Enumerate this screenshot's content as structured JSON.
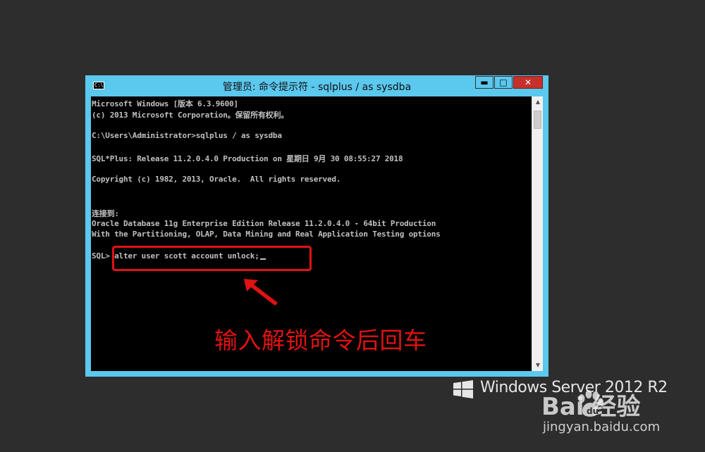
{
  "window": {
    "title": "管理员: 命令提示符 - sqlplus  / as sysdba",
    "icon_label": "C:\\",
    "minimize_label": "▬",
    "maximize_label": "□",
    "close_label": "✕"
  },
  "console": {
    "lines": [
      "Microsoft Windows [版本 6.3.9600]",
      "(c) 2013 Microsoft Corporation。保留所有权利。",
      "",
      "C:\\Users\\Administrator>sqlplus / as sysdba",
      "",
      "SQL*Plus: Release 11.2.0.4.0 Production on 星期日 9月 30 08:55:27 2018",
      "",
      "Copyright (c) 1982, 2013, Oracle.  All rights reserved.",
      "",
      "",
      "连接到:",
      "Oracle Database 11g Enterprise Edition Release 11.2.0.4.0 - 64bit Production",
      "With the Partitioning, OLAP, Data Mining and Real Application Testing options",
      ""
    ],
    "prompt": "SQL> ",
    "command": "alter user scott account unlock;"
  },
  "annotation": {
    "text": "输入解锁命令后回车",
    "color": "#e01212"
  },
  "branding": {
    "os_text": "Windows Server 2012 R2",
    "watermark_logo": "Bai   经验",
    "watermark_url": "jingyan.baidu.com"
  },
  "icons": [
    "cmd-icon",
    "minimize-icon",
    "maximize-icon",
    "close-icon",
    "scroll-up-icon",
    "scroll-down-icon",
    "windows-logo-icon",
    "baidu-paw-icon",
    "arrow-icon"
  ]
}
